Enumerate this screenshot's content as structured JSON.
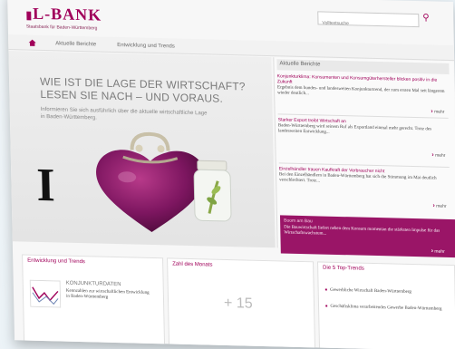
{
  "header": {
    "logo": "L-BANK",
    "tagline": "Staatsbank für Baden-Württemberg",
    "search_placeholder": "Volltextsuche"
  },
  "nav": {
    "items": [
      "Aktuelle Berichte",
      "Entwicklung und Trends"
    ]
  },
  "hero": {
    "title_line1": "WIE IST DIE LAGE DER WIRTSCHAFT?",
    "title_line2": "LESEN SIE NACH – UND VORAUS.",
    "intro": "Informieren Sie sich ausführlich über die aktuelle wirtschaftliche Lage in Baden-Württemberg.",
    "i_glyph": "I"
  },
  "sidebar": {
    "header": "Aktuelle Berichte",
    "news": [
      {
        "title": "Konjunkturklima: Konsumenten und Konsumgüterhersteller blicken positiv in die Zukunft",
        "text": "Ergebnis dem bundes- und landesweiten Konjunkturtrend, der zum ersten Mal seit längerem wieder deutlich...",
        "more": "mehr"
      },
      {
        "title": "Starker Export treibt Wirtschaft an",
        "text": "Baden-Württemberg wird seinem Ruf als Exportland einmal mehr gerecht. Trotz des landesweiten Entwicklung...",
        "more": "mehr"
      },
      {
        "title": "Einzelhändler trauen Kaufkraft der Verbraucher nicht",
        "text": "Bei den Einzelhändlern in Baden-Württemberg hat sich die Stimmung im Mai deutlich verschlechtert. Trotz...",
        "more": "mehr"
      }
    ],
    "banner": {
      "title": "Boom am Bau",
      "text": "Die Bauwirtschaft liefert neben dem Konsum momentan die stärksten Impulse für das Wirtschaftswachstum...",
      "more": "mehr"
    }
  },
  "panels": {
    "trends": {
      "title": "Entwicklung und Trends",
      "item_title": "KONJUNKTURDATEN",
      "item_text": "Kennzahlen zur wirtschaftlichen Entwicklung in Baden-Württemberg"
    },
    "zahl": {
      "title": "Zahl des Monats",
      "value": "+ 15"
    },
    "top_trends": {
      "title": "Die 5 Top-Trends",
      "items": [
        "Gewerbliche Wirtschaft Baden-Württemberg",
        "Geschäftsklima verarbeitendes Gewerbe Baden-Württemberg"
      ]
    }
  },
  "colors": {
    "brand": "#a0005a",
    "banner": "#9a1567"
  }
}
